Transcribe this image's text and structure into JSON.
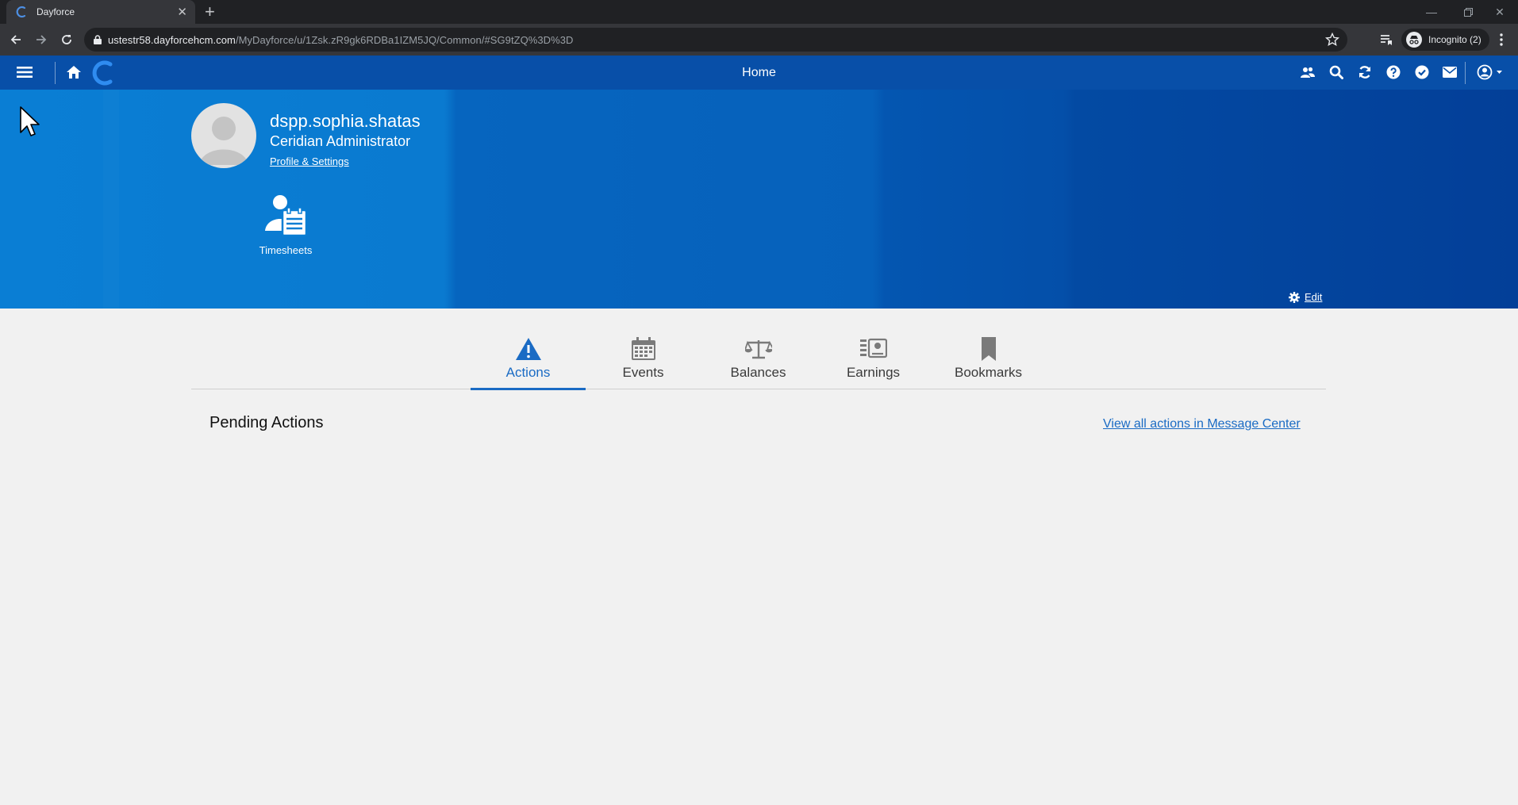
{
  "browser": {
    "tab_title": "Dayforce",
    "url_host": "ustestr58.dayforcehcm.com",
    "url_path": "/MyDayforce/u/1Zsk.zR9gk6RDBa1IZM5JQ/Common/#SG9tZQ%3D%3D",
    "incognito_label": "Incognito (2)"
  },
  "header": {
    "title": "Home"
  },
  "profile": {
    "username": "dspp.sophia.shatas",
    "role": "Ceridian Administrator",
    "settings_link": "Profile & Settings"
  },
  "tiles": [
    {
      "label": "Timesheets",
      "icon": "timesheets-icon"
    }
  ],
  "hero": {
    "edit_label": "Edit"
  },
  "tabs": [
    {
      "label": "Actions",
      "icon": "warning-icon",
      "active": true
    },
    {
      "label": "Events",
      "icon": "calendar-icon",
      "active": false
    },
    {
      "label": "Balances",
      "icon": "scale-icon",
      "active": false
    },
    {
      "label": "Earnings",
      "icon": "earnings-icon",
      "active": false
    },
    {
      "label": "Bookmarks",
      "icon": "bookmark-icon",
      "active": false
    }
  ],
  "pending": {
    "title": "Pending Actions",
    "message_center_link": "View all actions in Message Center"
  },
  "colors": {
    "app_header": "#084fa8",
    "hero": "#0a7ed4",
    "accent": "#1a6bc4",
    "page_bg": "#f1f1f1"
  }
}
